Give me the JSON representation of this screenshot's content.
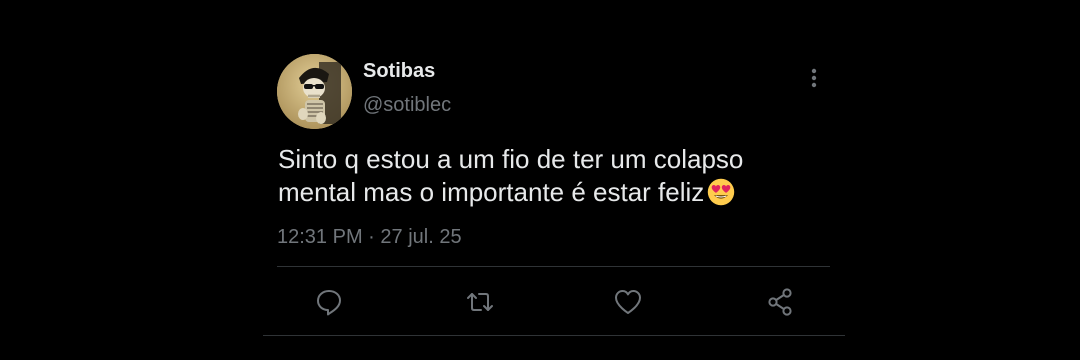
{
  "tweet": {
    "display_name": "Sotibas",
    "handle": "@sotiblec",
    "text": "Sinto q estou a um fio de ter um colapso mental mas o importante é estar feliz",
    "emoji": "smiling-face-with-heart-eyes",
    "time": "12:31 PM",
    "separator": "·",
    "date": "27 jul. 25"
  },
  "icons": {
    "more": "more-vertical-icon",
    "reply": "reply-icon",
    "retweet": "retweet-icon",
    "like": "heart-icon",
    "share": "share-icon"
  },
  "colors": {
    "background": "#000000",
    "primary_text": "#e7e9ea",
    "secondary_text": "#71767b",
    "divider": "#2f3336"
  }
}
